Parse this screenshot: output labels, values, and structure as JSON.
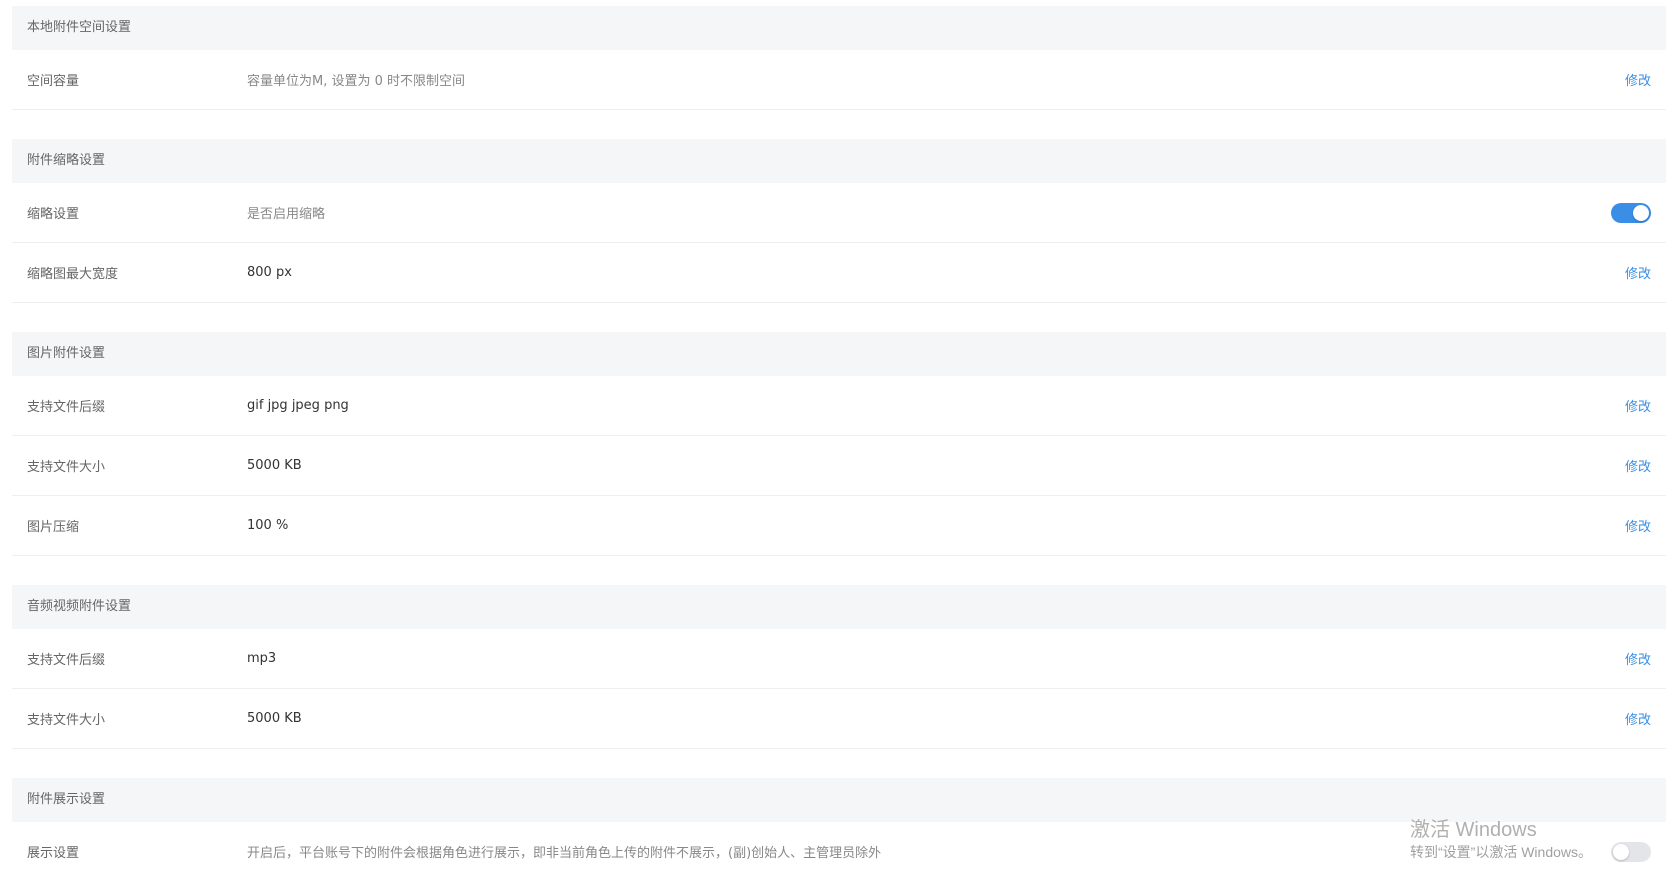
{
  "colors": {
    "accent": "#3a8ee6",
    "section_bg": "#f5f6f8",
    "divider": "#eceef1",
    "label_text": "#666666",
    "value_text": "#333333"
  },
  "sections": [
    {
      "title": "本地附件空间设置",
      "rows": [
        {
          "label": "空间容量",
          "value": "容量单位为M, 设置为 0 时不限制空间",
          "action": "修改"
        }
      ]
    },
    {
      "title": "附件缩略设置",
      "rows": [
        {
          "label": "缩略设置",
          "value": "是否启用缩略",
          "toggle_on": true
        },
        {
          "label": "缩略图最大宽度",
          "value": "800 px",
          "action": "修改"
        }
      ]
    },
    {
      "title": "图片附件设置",
      "rows": [
        {
          "label": "支持文件后缀",
          "value": "gif jpg jpeg png",
          "action": "修改"
        },
        {
          "label": "支持文件大小",
          "value": "5000 KB",
          "action": "修改"
        },
        {
          "label": "图片压缩",
          "value": "100 %",
          "action": "修改"
        }
      ]
    },
    {
      "title": "音频视频附件设置",
      "rows": [
        {
          "label": "支持文件后缀",
          "value": "mp3",
          "action": "修改"
        },
        {
          "label": "支持文件大小",
          "value": "5000 KB",
          "action": "修改"
        }
      ]
    },
    {
      "title": "附件展示设置",
      "rows": [
        {
          "label": "展示设置",
          "value": "开启后，平台账号下的附件会根据角色进行展示，即非当前角色上传的附件不展示，(副)创始人、主管理员除外",
          "toggle_on": false
        }
      ]
    }
  ],
  "watermark": {
    "title": "激活 Windows",
    "subtitle": "转到“设置”以激活 Windows。"
  }
}
